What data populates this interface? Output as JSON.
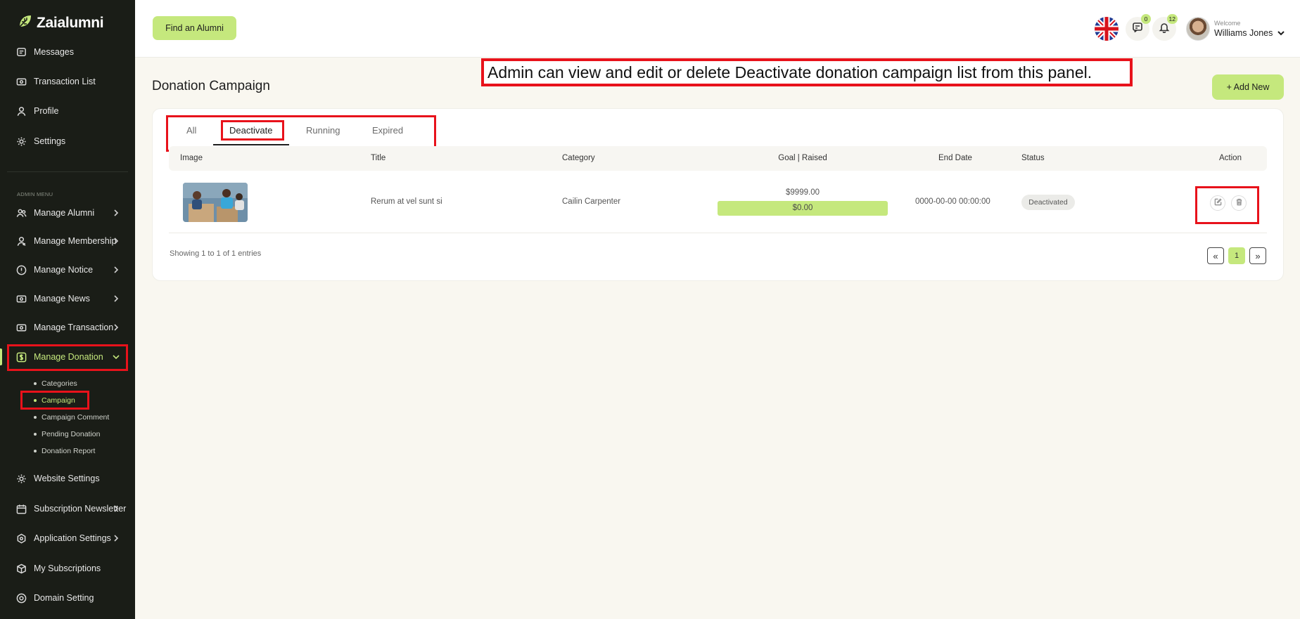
{
  "brand": {
    "name": "Zaialumni",
    "accent": "#c5e87d",
    "sidebar_bg": "#1a1d17",
    "annotation_color": "#e8121b"
  },
  "sidebar": {
    "top_items": [
      {
        "label": "Messages",
        "icon": "message-icon"
      },
      {
        "label": "Transaction List",
        "icon": "wallet-icon"
      },
      {
        "label": "Profile",
        "icon": "user-icon"
      },
      {
        "label": "Settings",
        "icon": "gear-icon"
      }
    ],
    "menu_label": "ADMIN MENU",
    "admin_items": [
      {
        "label": "Manage Alumni",
        "icon": "users-icon"
      },
      {
        "label": "Manage Membership",
        "icon": "membership-icon"
      },
      {
        "label": "Manage Notice",
        "icon": "alert-icon"
      },
      {
        "label": "Manage News",
        "icon": "news-icon"
      },
      {
        "label": "Manage Transaction",
        "icon": "transaction-icon"
      },
      {
        "label": "Manage Donation",
        "icon": "dollar-icon",
        "active": true
      }
    ],
    "donation_sub_items": [
      {
        "label": "Categories"
      },
      {
        "label": "Campaign",
        "active": true
      },
      {
        "label": "Campaign Comment"
      },
      {
        "label": "Pending Donation"
      },
      {
        "label": "Donation Report"
      }
    ],
    "bottom_items": [
      {
        "label": "Website Settings",
        "icon": "gear-icon"
      },
      {
        "label": "Subscription Newsletter",
        "icon": "calendar-icon"
      },
      {
        "label": "Application Settings",
        "icon": "hexagon-icon"
      },
      {
        "label": "My Subscriptions",
        "icon": "box-icon"
      },
      {
        "label": "Domain Setting",
        "icon": "target-icon"
      }
    ]
  },
  "header": {
    "find_alumni_label": "Find an Alumni",
    "language_icon": "uk-flag-icon",
    "messages_count": "0",
    "notifications_count": "12",
    "welcome_label": "Welcome",
    "user_name": "Williams Jones"
  },
  "annotation": {
    "text": "Admin can view and edit or delete Deactivate donation campaign list from this panel."
  },
  "main": {
    "title": "Donation Campaign",
    "add_new_label": "+ Add New",
    "tabs": [
      {
        "label": "All"
      },
      {
        "label": "Deactivate",
        "active": true
      },
      {
        "label": "Running"
      },
      {
        "label": "Expired"
      }
    ],
    "table": {
      "columns": [
        "Image",
        "Title",
        "Category",
        "Goal | Raised",
        "End Date",
        "Status",
        "Action"
      ],
      "rows": [
        {
          "title": "Rerum at vel sunt si",
          "category": "Cailin Carpenter",
          "goal": "$9999.00",
          "raised": "$0.00",
          "raised_fraction": 1.0,
          "end_date": "0000-00-00 00:00:00",
          "status": "Deactivated"
        }
      ]
    },
    "showing_text": "Showing 1 to 1 of 1 entries",
    "pagination": {
      "prev": "«",
      "current": "1",
      "next": "»"
    }
  }
}
